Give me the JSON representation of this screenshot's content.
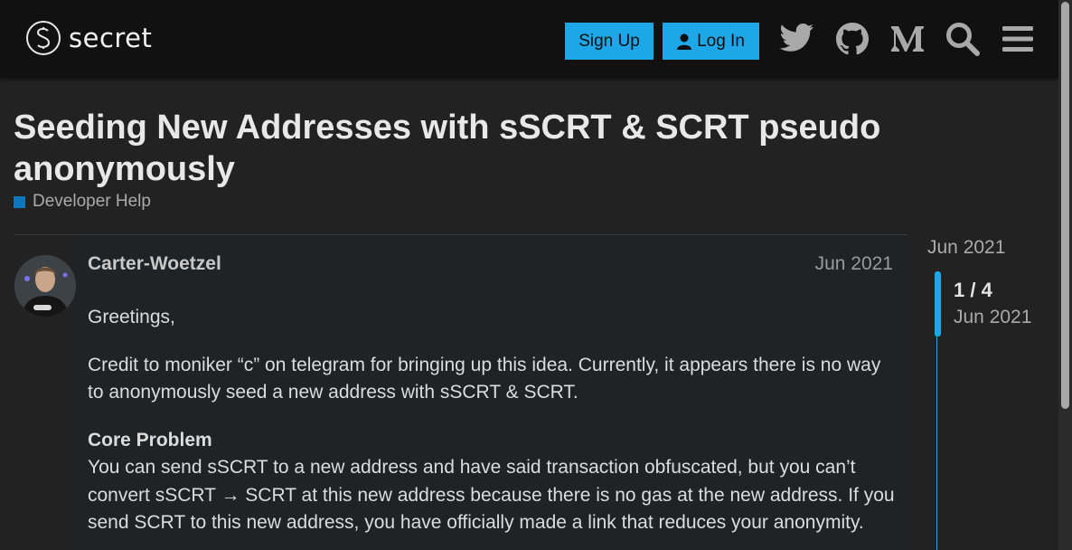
{
  "header": {
    "logo_text": "secret",
    "signup_label": "Sign Up",
    "login_label": "Log In",
    "icons": [
      "twitter-icon",
      "github-icon",
      "medium-icon",
      "search-icon",
      "menu-icon"
    ]
  },
  "topic": {
    "title": "Seeding New Addresses with sSCRT & SCRT pseudo anonymously",
    "category": "Developer Help",
    "category_color": "#0e76bd"
  },
  "post": {
    "username": "Carter-Woetzel",
    "date": "Jun 2021",
    "greeting": "Greetings,",
    "para1": "Credit to moniker “c” on telegram for bringing up this idea. Currently, it appears there is no way to anonymously seed a new address with sSCRT & SCRT.",
    "heading": "Core Problem",
    "para2": "You can send sSCRT to a new address and have said transaction obfuscated, but you can’t convert sSCRT → SCRT at this new address because there is no gas at the new address. If you send SCRT to this new address, you have officially made a link that reduces your anonymity."
  },
  "timeline": {
    "start_date": "Jun 2021",
    "position": "1 / 4",
    "current_date": "Jun 2021",
    "accent": "#1ea7e8"
  }
}
